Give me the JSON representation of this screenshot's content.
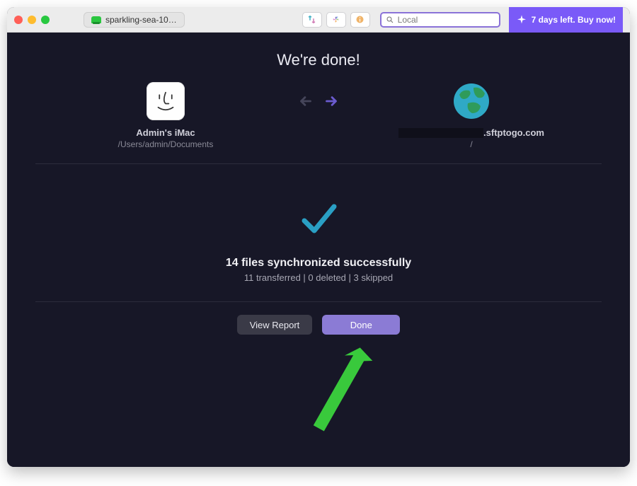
{
  "titlebar": {
    "tab_label": "sparkling-sea-10…",
    "search_placeholder": "Local",
    "trial_text": "7 days left. Buy now!"
  },
  "header": {
    "title": "We're done!"
  },
  "local": {
    "name": "Admin's iMac",
    "path": "/Users/admin/Documents"
  },
  "remote": {
    "name_suffix": ".sftptogo.com",
    "path": "/"
  },
  "status": {
    "main": "14 files synchronized successfully",
    "sub": "11 transferred | 0 deleted | 3 skipped"
  },
  "actions": {
    "view_report": "View Report",
    "done": "Done"
  }
}
